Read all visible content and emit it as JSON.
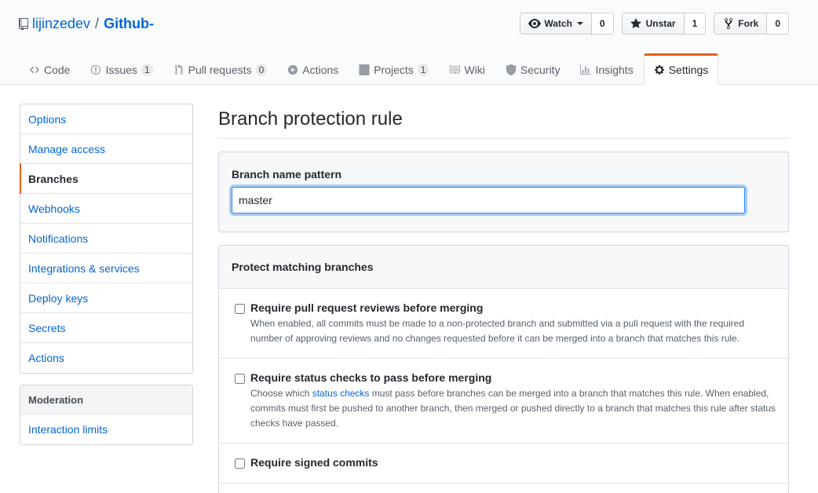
{
  "repo": {
    "owner": "lijinzedev",
    "separator": "/",
    "name": "Github-"
  },
  "actions": {
    "watch_label": "Watch",
    "watch_count": "0",
    "unstar_label": "Unstar",
    "unstar_count": "1",
    "fork_label": "Fork",
    "fork_count": "0"
  },
  "tabs": [
    {
      "label": "Code",
      "icon": "code-icon"
    },
    {
      "label": "Issues",
      "icon": "issue-icon",
      "counter": "1"
    },
    {
      "label": "Pull requests",
      "icon": "pull-request-icon",
      "counter": "0"
    },
    {
      "label": "Actions",
      "icon": "play-icon"
    },
    {
      "label": "Projects",
      "icon": "project-icon",
      "counter": "1"
    },
    {
      "label": "Wiki",
      "icon": "book-icon"
    },
    {
      "label": "Security",
      "icon": "shield-icon"
    },
    {
      "label": "Insights",
      "icon": "graph-icon"
    },
    {
      "label": "Settings",
      "icon": "gear-icon",
      "selected": true
    }
  ],
  "sidebar": {
    "items": [
      "Options",
      "Manage access",
      "Branches",
      "Webhooks",
      "Notifications",
      "Integrations & services",
      "Deploy keys",
      "Secrets",
      "Actions"
    ],
    "selected": "Branches",
    "moderation_heading": "Moderation",
    "moderation_items": [
      "Interaction limits"
    ]
  },
  "main": {
    "title": "Branch protection rule",
    "pattern_label": "Branch name pattern",
    "pattern_value": "master",
    "protect_heading": "Protect matching branches",
    "rules": [
      {
        "title": "Require pull request reviews before merging",
        "desc": "When enabled, all commits must be made to a non-protected branch and submitted via a pull request with the required number of approving reviews and no changes requested before it can be merged into a branch that matches this rule.",
        "checked": false
      },
      {
        "title": "Require status checks to pass before merging",
        "desc_before": "Choose which ",
        "desc_link": "status checks",
        "desc_after": " must pass before branches can be merged into a branch that matches this rule. When enabled, commits must first be pushed to another branch, then merged or pushed directly to a branch that matches this rule after status checks have passed.",
        "checked": false
      },
      {
        "title": "Require signed commits",
        "checked": false
      }
    ]
  },
  "colors": {
    "accent": "#e36209",
    "link": "#0366d6",
    "focus": "#2188ff"
  }
}
